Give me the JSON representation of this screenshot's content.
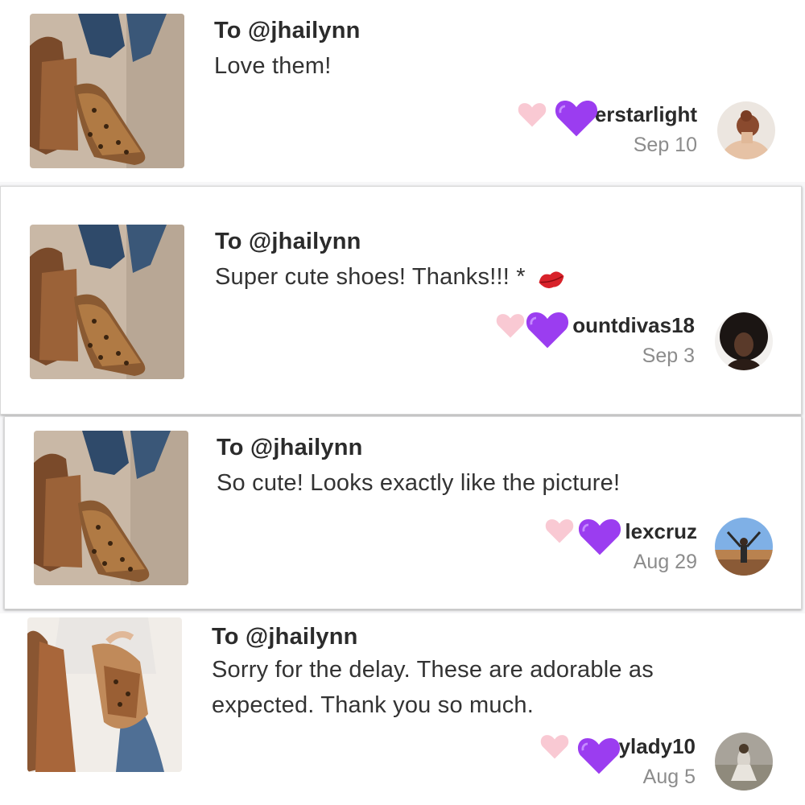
{
  "reviews": [
    {
      "to_label": "To @jhailynn",
      "message": "Love them!",
      "username_visible": "erstarlight",
      "date": "Sep 10",
      "product_image": "leopard-flats-product-photo",
      "avatar_image": "user-avatar-woman-bun"
    },
    {
      "to_label": "To @jhailynn",
      "message": "Super cute shoes! Thanks!!! *",
      "message_emoji": "kiss-mark-emoji",
      "username_visible": "ountdivas18",
      "date": "Sep 3",
      "product_image": "leopard-flats-product-photo",
      "avatar_image": "user-avatar-curly-hair"
    },
    {
      "to_label": "To @jhailynn",
      "message": "So cute! Looks exactly like the picture!",
      "username_visible": "lexcruz",
      "date": "Aug 29",
      "product_image": "leopard-flats-product-photo",
      "avatar_image": "user-avatar-canyon"
    },
    {
      "to_label": "To @jhailynn",
      "message_line1": "Sorry for the delay. These are adorable as",
      "message_line2": "expected. Thank you so much.",
      "username_visible": "ylady10",
      "date": "Aug 5",
      "product_image": "leopard-flats-bag-photo",
      "avatar_image": "user-avatar-field"
    }
  ],
  "icons": {
    "like": "pink-heart-icon",
    "overlay": "purple-heart-emoji"
  },
  "colors": {
    "like_heart": "#f9c9d3",
    "purple_heart": "#9b3df0",
    "username": "#2a2a2a",
    "date": "#8c8c8c"
  }
}
